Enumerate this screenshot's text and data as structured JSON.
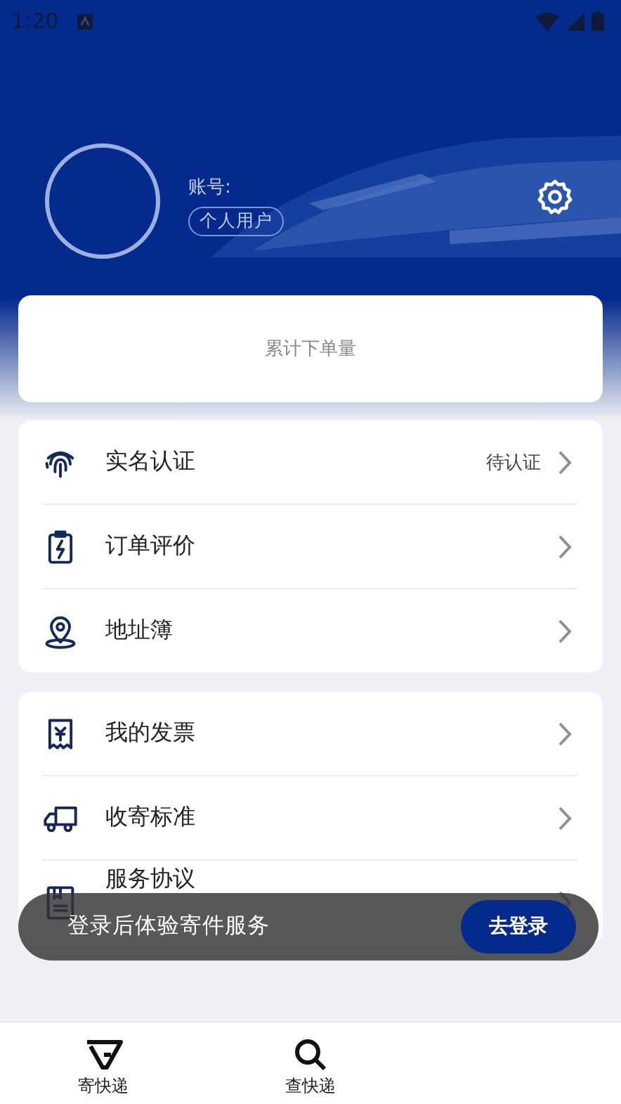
{
  "status_bar": {
    "time": "1:20"
  },
  "profile": {
    "account_label": "账号:",
    "user_type": "个人用户"
  },
  "stats_card": {
    "label": "累计下单量"
  },
  "menu_groups": [
    {
      "items": [
        {
          "kind": "fingerprint",
          "label": "实名认证",
          "status": "待认证"
        },
        {
          "kind": "clipboard",
          "label": "订单评价"
        },
        {
          "kind": "location",
          "label": "地址簿"
        }
      ]
    },
    {
      "items": [
        {
          "kind": "invoice",
          "label": "我的发票"
        },
        {
          "kind": "truck",
          "label": "收寄标准"
        },
        {
          "kind": "book",
          "label": "服务协议"
        }
      ]
    }
  ],
  "toast": {
    "message": "登录后体验寄件服务",
    "button": "去登录"
  },
  "bottom_nav": [
    {
      "kind": "send",
      "label": "寄快递"
    },
    {
      "kind": "search",
      "label": "查快递"
    }
  ]
}
